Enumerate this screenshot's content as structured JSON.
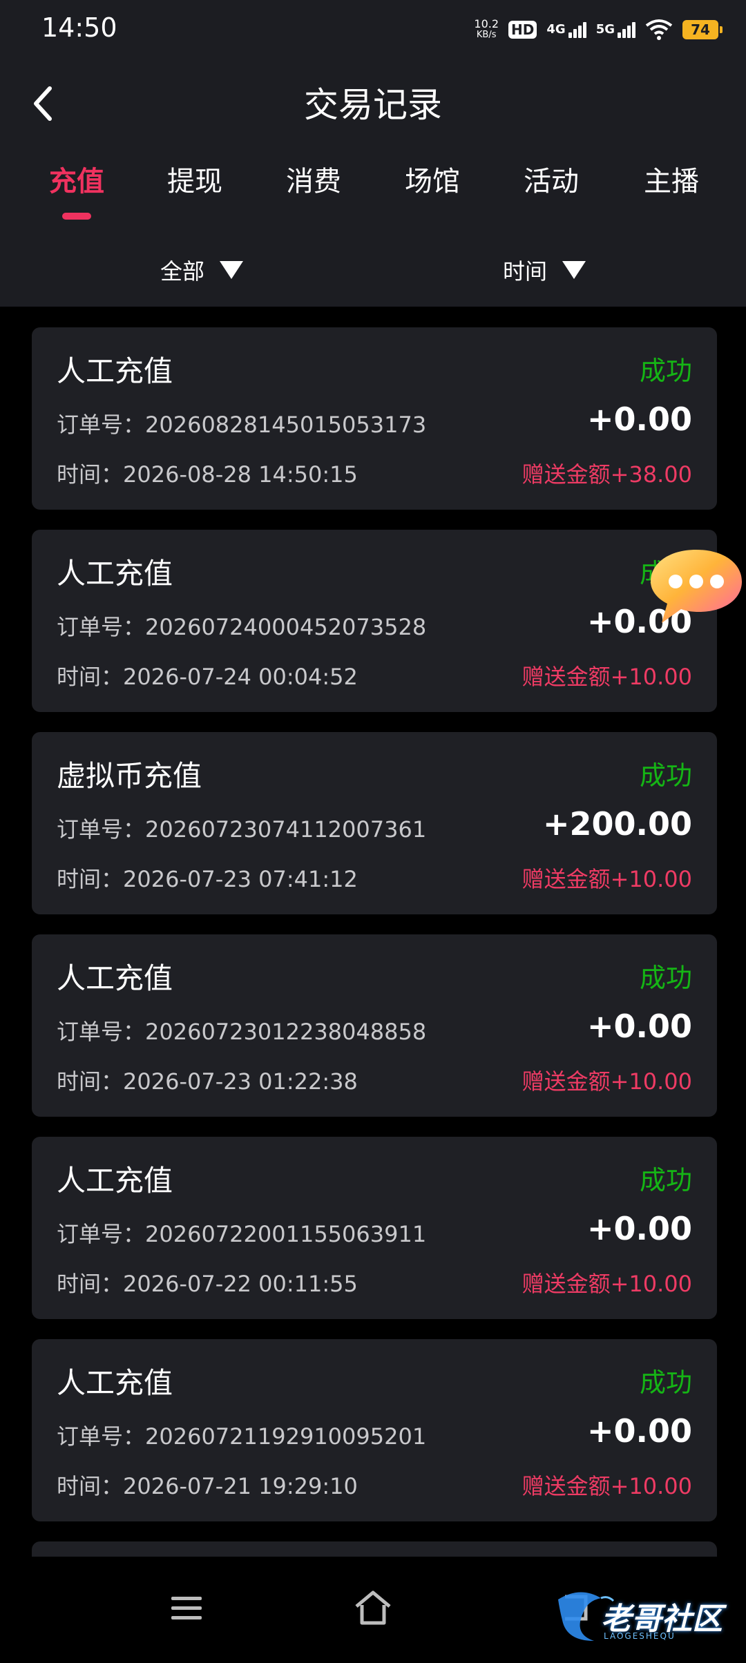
{
  "status_bar": {
    "time": "14:50",
    "net_speed_value": "10.2",
    "net_speed_unit": "KB/s",
    "hd_label": "HD",
    "signal_1_label": "4G",
    "signal_2_label": "5G",
    "battery": "74"
  },
  "header": {
    "title": "交易记录"
  },
  "tabs": [
    {
      "label": "充值",
      "active": true
    },
    {
      "label": "提现"
    },
    {
      "label": "消费"
    },
    {
      "label": "场馆"
    },
    {
      "label": "活动"
    },
    {
      "label": "主播"
    }
  ],
  "filters": {
    "category": "全部",
    "time": "时间"
  },
  "records": [
    {
      "type": "人工充值",
      "status": "成功",
      "order": "订单号：20260828145015053173",
      "amount": "+0.00",
      "time": "时间：2026-08-28 14:50:15",
      "bonus": "赠送金额+38.00"
    },
    {
      "type": "人工充值",
      "status": "成功",
      "order": "订单号：20260724000452073528",
      "amount": "+0.00",
      "time": "时间：2026-07-24 00:04:52",
      "bonus": "赠送金额+10.00"
    },
    {
      "type": "虚拟币充值",
      "status": "成功",
      "order": "订单号：20260723074112007361",
      "amount": "+200.00",
      "time": "时间：2026-07-23 07:41:12",
      "bonus": "赠送金额+10.00"
    },
    {
      "type": "人工充值",
      "status": "成功",
      "order": "订单号：20260723012238048858",
      "amount": "+0.00",
      "time": "时间：2026-07-23 01:22:38",
      "bonus": "赠送金额+10.00"
    },
    {
      "type": "人工充值",
      "status": "成功",
      "order": "订单号：20260722001155063911",
      "amount": "+0.00",
      "time": "时间：2026-07-22 00:11:55",
      "bonus": "赠送金额+10.00"
    },
    {
      "type": "人工充值",
      "status": "成功",
      "order": "订单号：20260721192910095201",
      "amount": "+0.00",
      "time": "时间：2026-07-21 19:29:10",
      "bonus": "赠送金额+10.00"
    }
  ],
  "colors": {
    "accent": "#f0325f",
    "success": "#15b515",
    "bonus": "#ee3b64",
    "card_bg": "#1f2025",
    "header_bg": "#1c1d22"
  },
  "icons": {
    "back": "chevron-left-icon",
    "dropdown": "triangle-down-icon",
    "float": "chat-bubble-icon",
    "nav_menu": "menu-icon",
    "nav_home": "home-icon",
    "nav_back": "back-icon"
  },
  "watermark": {
    "text": "老哥社区",
    "subtext": "LAOGESHEQU"
  }
}
